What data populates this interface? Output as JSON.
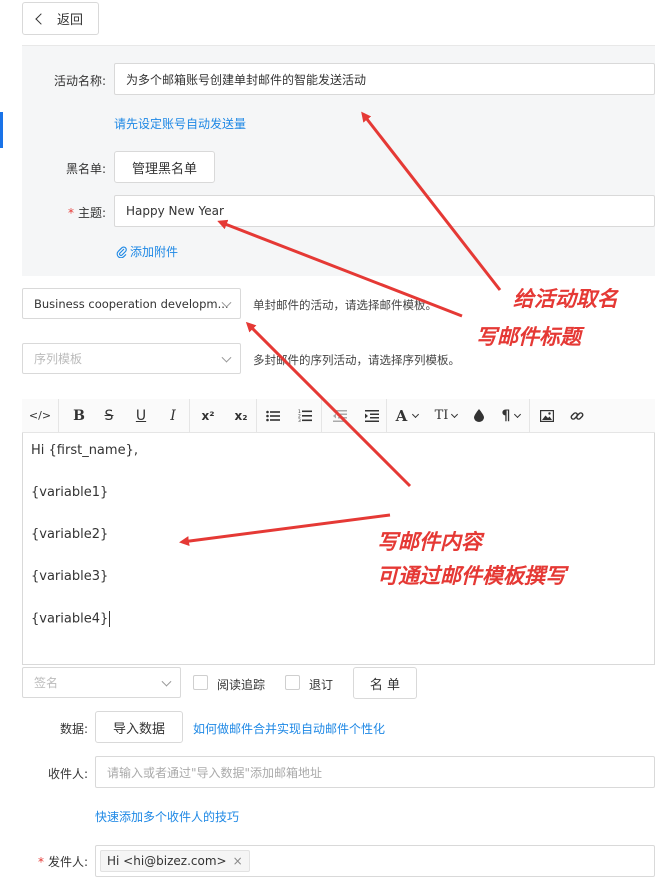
{
  "header": {
    "back_label": "返回"
  },
  "form": {
    "activity_name": {
      "label": "活动名称:",
      "value": "为多个邮箱账号创建单封邮件的智能发送活动"
    },
    "auto_send_link": "请先设定账号自动发送量",
    "blacklist": {
      "label": "黑名单:",
      "button": "管理黑名单"
    },
    "subject": {
      "required_mark": "*",
      "label": "主题:",
      "value": "Happy New Year"
    },
    "attachment_link": "添加附件",
    "template_select": {
      "value": "Business cooperation developm...",
      "hint": "单封邮件的活动，请选择邮件模板。"
    },
    "sequence_select": {
      "placeholder": "序列模板",
      "hint": "多封邮件的序列活动，请选择序列模板。"
    }
  },
  "toolbar": {
    "code": "</>",
    "bold": "B",
    "strike": "S",
    "underline": "U",
    "italic": "I",
    "sup": "x²",
    "sub": "x₂",
    "font": "A",
    "size": "TI",
    "para": "¶"
  },
  "editor": {
    "lines": [
      "Hi {first_name},",
      "{variable1}",
      "{variable2}",
      "{variable3}",
      "{variable4}"
    ]
  },
  "bottom": {
    "signature_placeholder": "签名",
    "read_tracking": "阅读追踪",
    "unsubscribe": "退订",
    "list_button": "名 单",
    "data_label": "数据:",
    "import_button": "导入数据",
    "merge_link": "如何做邮件合并实现自动邮件个性化",
    "recipient_label": "收件人:",
    "recipient_placeholder": "请输入或者通过\"导入数据\"添加邮箱地址",
    "quick_add_link": "快速添加多个收件人的技巧",
    "sender_required": "*",
    "sender_label": "发件人:",
    "sender_tag": "Hi <hi@bizez.com>",
    "sender_tag_close": "×"
  },
  "annotations": {
    "name_activity": "给活动取名",
    "write_subject": "写邮件标题",
    "write_content": "写邮件内容",
    "via_template": "可通过邮件模板撰写"
  },
  "colors": {
    "accent": "#1e88e5",
    "annotation": "#e53935"
  }
}
